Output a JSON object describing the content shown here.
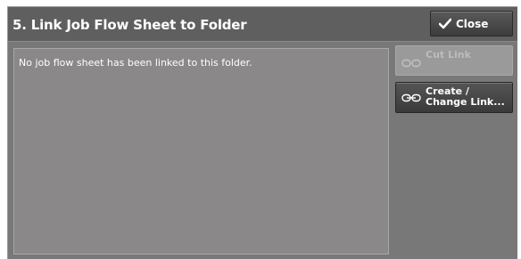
{
  "window": {
    "title": "5. Link Job Flow Sheet to Folder"
  },
  "toolbar": {
    "close_label": "Close",
    "close_icon": "checkmark-icon"
  },
  "message": {
    "text": "No job flow sheet has been linked to this folder."
  },
  "actions": {
    "cut_link": {
      "label": "Cut Link",
      "icon": "chain-link-icon",
      "enabled": false
    },
    "change_link": {
      "label_line1": "Create /",
      "label_line2": "Change Link...",
      "icon": "chain-link-icon",
      "enabled": true
    }
  },
  "colors": {
    "title_bar": "#5f5f5f",
    "background": "#787878",
    "panel": "#8b8889",
    "button_dark": "#3c3c3c",
    "button_disabled": "#9a9a9a",
    "text": "#ffffff"
  }
}
